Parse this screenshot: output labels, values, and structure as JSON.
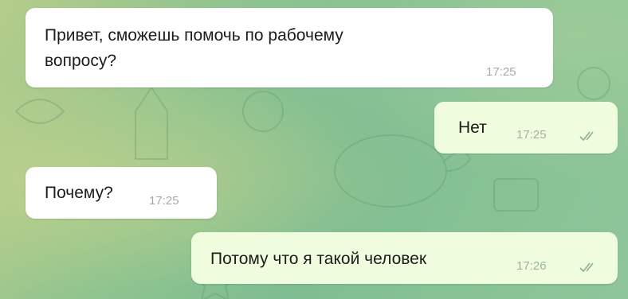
{
  "messages": [
    {
      "direction": "incoming",
      "text_line1": "Привет, сможешь помочь по рабочему",
      "text_line2": "вопросу?",
      "time": "17:25"
    },
    {
      "direction": "outgoing",
      "text": "Нет",
      "time": "17:25",
      "status_icon": "double-check-icon"
    },
    {
      "direction": "incoming",
      "text": "Почему?",
      "time": "17:25"
    },
    {
      "direction": "outgoing",
      "text": "Потому что я такой человек",
      "time": "17:26",
      "status_icon": "double-check-icon"
    }
  ],
  "colors": {
    "incoming_bubble": "#ffffff",
    "outgoing_bubble": "#effdde",
    "wallpaper": "#8fc48f",
    "check_color": "#8fb08c"
  }
}
